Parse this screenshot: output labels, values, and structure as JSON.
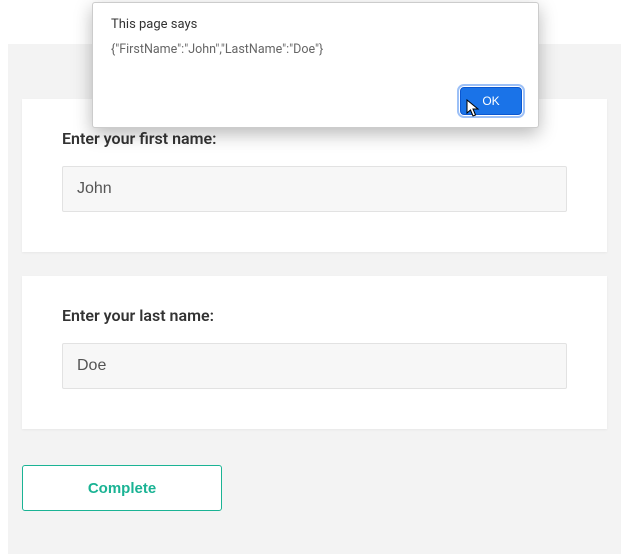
{
  "form": {
    "firstName": {
      "label": "Enter your first name:",
      "value": "John"
    },
    "lastName": {
      "label": "Enter your last name:",
      "value": "Doe"
    },
    "completeButton": "Complete"
  },
  "alert": {
    "title": "This page says",
    "message": "{\"FirstName\":\"John\",\"LastName\":\"Doe\"}",
    "okLabel": "OK"
  },
  "colors": {
    "accent": "#1ab394",
    "dialogButton": "#1a73e8"
  }
}
